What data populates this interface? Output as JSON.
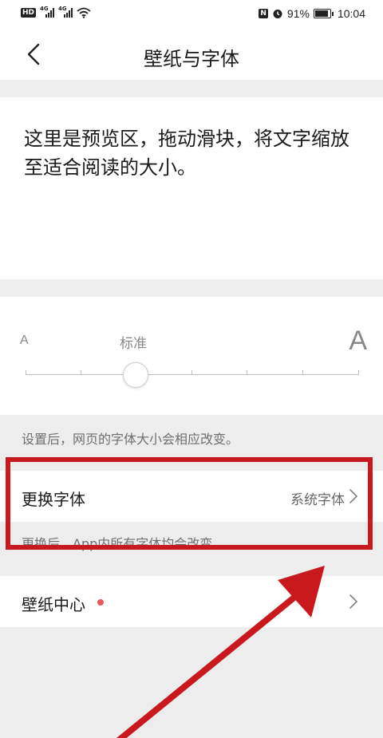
{
  "status_bar": {
    "hd_badge": "HD",
    "signal_1_tag": "4G",
    "signal_2_tag": "4G",
    "nfc_label": "N",
    "battery": "91%",
    "time": "10:04"
  },
  "nav": {
    "title": "壁纸与字体"
  },
  "preview": {
    "text": "这里是预览区，拖动滑块，将文字缩放至适合阅读的大小。"
  },
  "font_size": {
    "small_label": "A",
    "large_label": "A",
    "current_label": "标准",
    "steps": 7,
    "selected_step": 2,
    "hint": "设置后，网页的字体大小会相应改变。"
  },
  "font_setting": {
    "label": "更换字体",
    "value": "系统字体",
    "hint": "更换后，App内所有字体均会改变"
  },
  "wallpaper": {
    "label": "壁纸中心",
    "has_badge": true
  },
  "colors": {
    "annotation": "#c8191f",
    "badge": "#e8595b",
    "background": "#ededed"
  }
}
